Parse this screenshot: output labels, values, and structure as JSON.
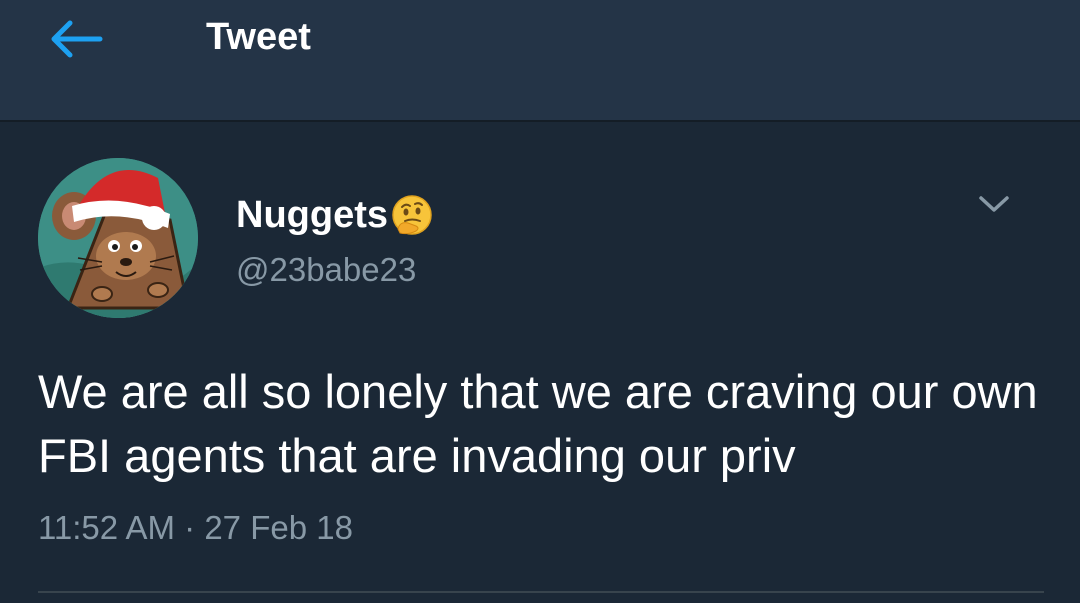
{
  "header": {
    "title": "Tweet",
    "back_icon": "arrow-left-icon",
    "accent_color": "#1da1f2"
  },
  "tweet": {
    "display_name": "Nuggets",
    "name_emoji": "thinking-face-emoji",
    "handle": "@23babe23",
    "text": "We are all so lonely that we are craving our own FBI agents that are invading our priv",
    "time": "11:52 AM",
    "separator": "·",
    "date": "27 Feb 18",
    "menu_icon": "chevron-down-icon",
    "avatar": "avatar (cartoon mouse with santa hat)"
  },
  "colors": {
    "background": "#1b2836",
    "header_background": "#243447",
    "secondary_text": "#8899a6"
  }
}
